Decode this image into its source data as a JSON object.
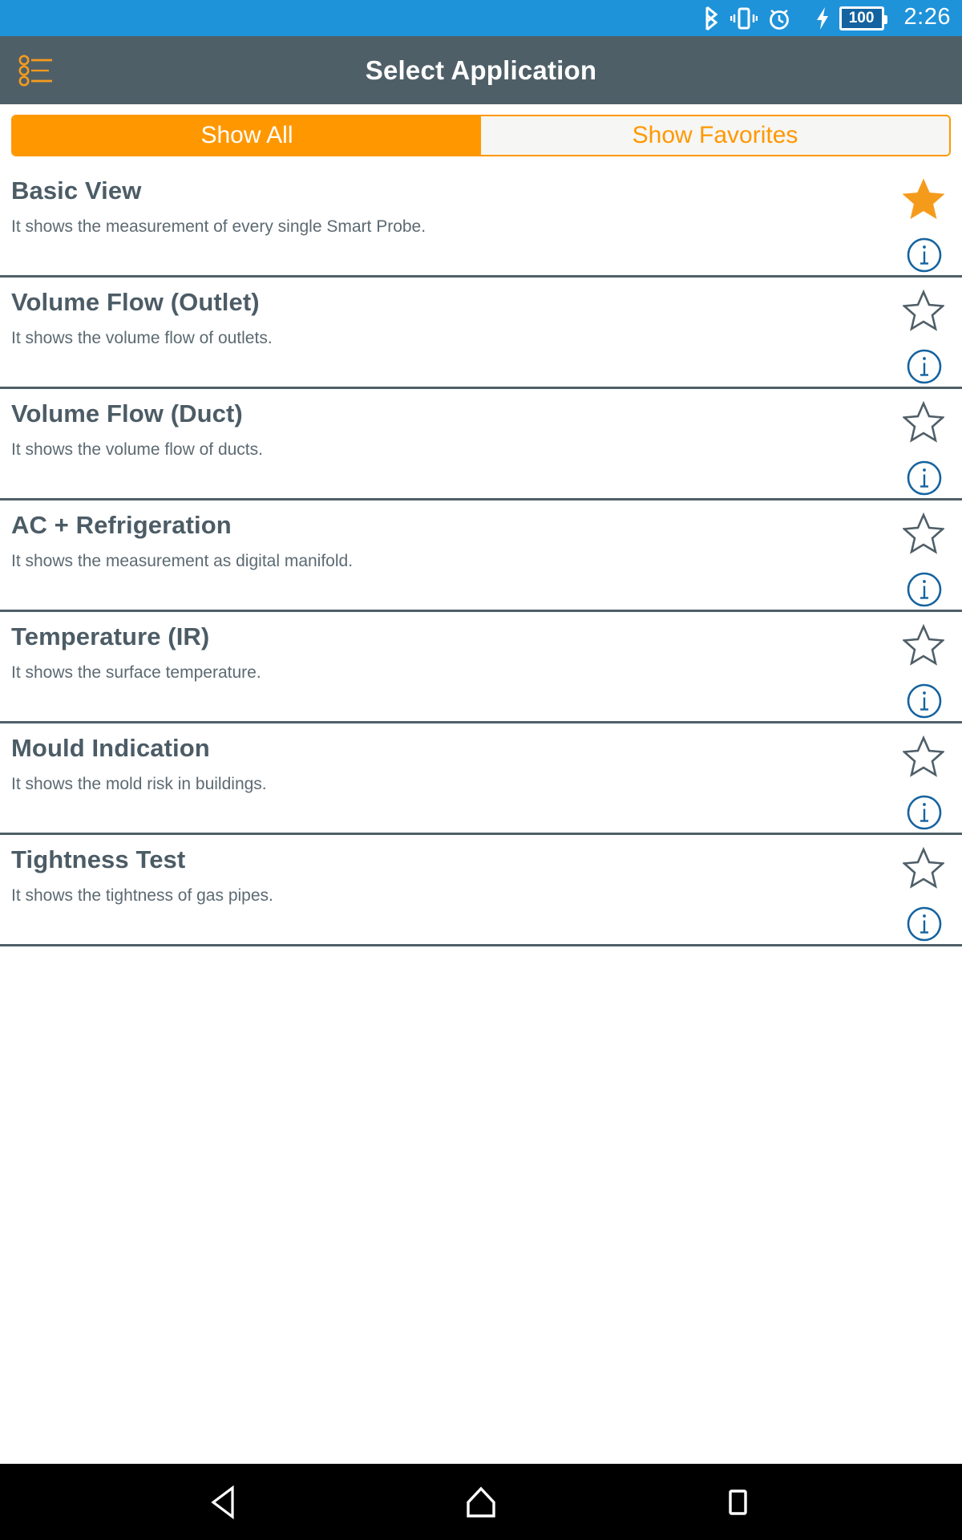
{
  "status_bar": {
    "background": "#1f93d9",
    "time": "2:26",
    "battery_level": "100",
    "icons": [
      "bluetooth-icon",
      "vibrate-icon",
      "alarm-icon",
      "charging-bolt-icon",
      "battery-icon"
    ]
  },
  "app_bar": {
    "background": "#4f5f68",
    "title": "Select Application",
    "menu_icon": "list-menu-icon",
    "menu_icon_color": "#F59B1C"
  },
  "tabs": {
    "accent": "#FF9800",
    "inactive_background": "#f6f6f4",
    "items": [
      {
        "label": "Show All",
        "active": true
      },
      {
        "label": "Show Favorites",
        "active": false
      }
    ]
  },
  "list": {
    "separator_color": "#4f5f68",
    "star_filled_color": "#F59B1C",
    "star_outline_color": "#4f5f68",
    "info_icon_color": "#15639f",
    "items": [
      {
        "title": "Basic View",
        "description": "It shows the measurement of every single Smart Probe.",
        "favorite": true,
        "star_icon": "star-filled-icon",
        "info_icon": "info-circle-icon"
      },
      {
        "title": "Volume Flow (Outlet)",
        "description": "It shows the volume flow of outlets.",
        "favorite": false,
        "star_icon": "star-outline-icon",
        "info_icon": "info-circle-icon"
      },
      {
        "title": "Volume Flow (Duct)",
        "description": "It shows the volume flow of ducts.",
        "favorite": false,
        "star_icon": "star-outline-icon",
        "info_icon": "info-circle-icon"
      },
      {
        "title": "AC + Refrigeration",
        "description": "It shows the measurement as digital manifold.",
        "favorite": false,
        "star_icon": "star-outline-icon",
        "info_icon": "info-circle-icon"
      },
      {
        "title": "Temperature (IR)",
        "description": "It shows the surface temperature.",
        "favorite": false,
        "star_icon": "star-outline-icon",
        "info_icon": "info-circle-icon"
      },
      {
        "title": "Mould Indication",
        "description": "It shows the mold risk in buildings.",
        "favorite": false,
        "star_icon": "star-outline-icon",
        "info_icon": "info-circle-icon"
      },
      {
        "title": "Tightness Test",
        "description": "It shows the tightness of gas pipes.",
        "favorite": false,
        "star_icon": "star-outline-icon",
        "info_icon": "info-circle-icon"
      }
    ]
  },
  "nav_bar": {
    "background": "#000000",
    "buttons": [
      {
        "name": "back-button",
        "icon": "back-triangle-icon"
      },
      {
        "name": "home-button",
        "icon": "home-icon"
      },
      {
        "name": "recents-button",
        "icon": "square-recents-icon"
      }
    ]
  }
}
